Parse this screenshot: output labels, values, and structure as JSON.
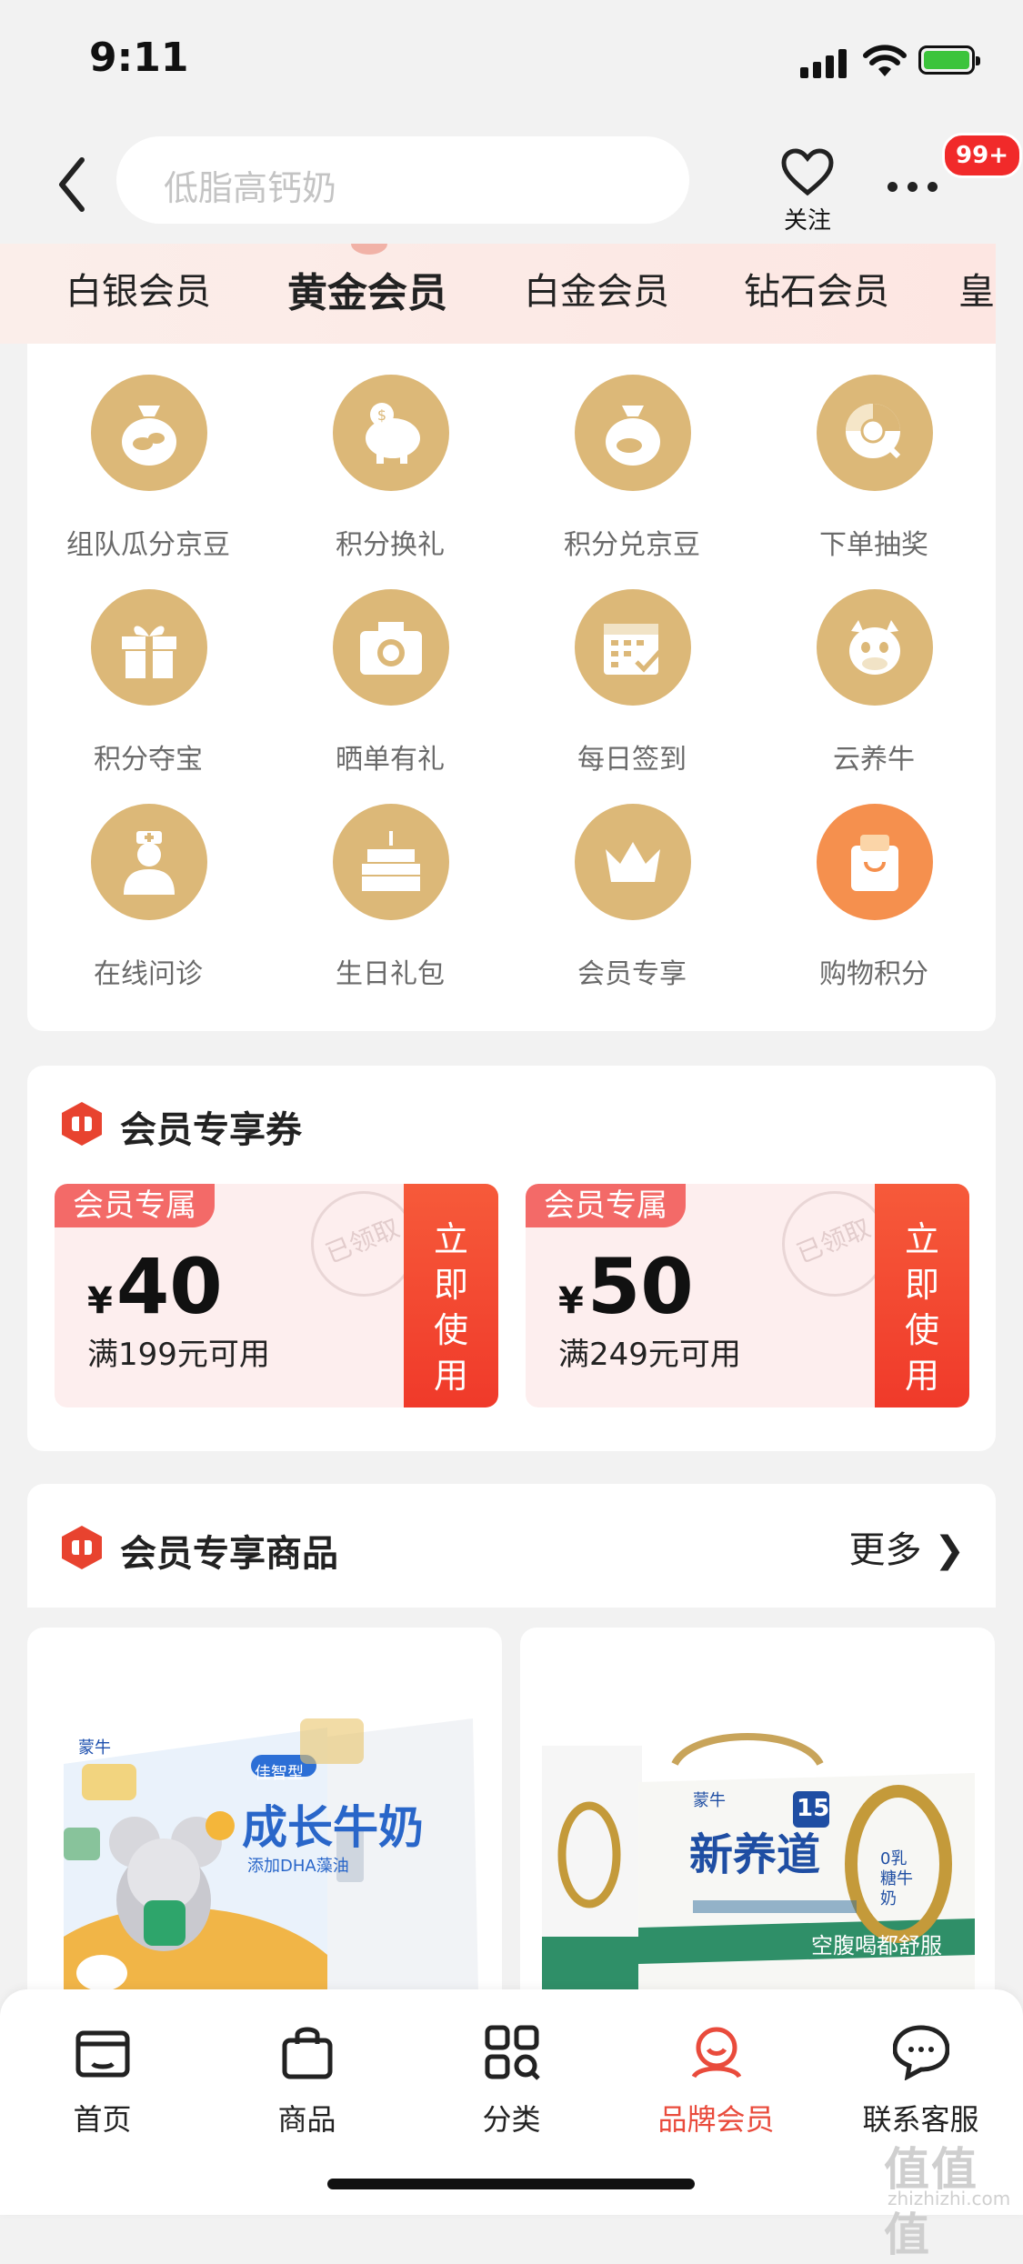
{
  "status": {
    "time": "9:11"
  },
  "header": {
    "search_placeholder": "低脂高钙奶",
    "follow_label": "关注",
    "badge": "99+"
  },
  "tiers": [
    "白银会员",
    "黄金会员",
    "白金会员",
    "钻石会员",
    "皇"
  ],
  "active_tier_index": 1,
  "benefits": [
    {
      "label": "组队瓜分京豆",
      "icon": "bean-bag-icon"
    },
    {
      "label": "积分换礼",
      "icon": "piggy-bank-icon"
    },
    {
      "label": "积分兑京豆",
      "icon": "bean-bag-icon"
    },
    {
      "label": "下单抽奖",
      "icon": "lottery-wheel-icon"
    },
    {
      "label": "积分夺宝",
      "icon": "gift-box-icon"
    },
    {
      "label": "晒单有礼",
      "icon": "camera-icon"
    },
    {
      "label": "每日签到",
      "icon": "calendar-icon"
    },
    {
      "label": "云养牛",
      "icon": "cow-icon"
    },
    {
      "label": "在线问诊",
      "icon": "doctor-icon"
    },
    {
      "label": "生日礼包",
      "icon": "cake-icon"
    },
    {
      "label": "会员专享",
      "icon": "crown-icon"
    },
    {
      "label": "购物积分",
      "icon": "shopping-bag-icon"
    }
  ],
  "coupons_section": {
    "title": "会员专享券",
    "coupons": [
      {
        "tag": "会员专属",
        "currency": "¥",
        "amount": "40",
        "condition": "满199元可用",
        "stamp": "已领取",
        "button": "立即使用"
      },
      {
        "tag": "会员专属",
        "currency": "¥",
        "amount": "50",
        "condition": "满249元可用",
        "stamp": "已领取",
        "button": "立即使用"
      }
    ]
  },
  "goods_section": {
    "title": "会员专享商品",
    "more": "更多",
    "more_arrow": "❯",
    "products": [
      {
        "brand": "蒙牛",
        "name": "成长牛奶",
        "sub": "佳智型",
        "note": "添加DHA藻油"
      },
      {
        "brand": "蒙牛",
        "name": "新养道",
        "sub": "0乳糖牛奶",
        "note": "空腹喝都舒服",
        "count": "15"
      }
    ]
  },
  "tabbar": [
    {
      "label": "首页",
      "icon": "shop-icon"
    },
    {
      "label": "商品",
      "icon": "bag-icon"
    },
    {
      "label": "分类",
      "icon": "category-icon"
    },
    {
      "label": "品牌会员",
      "icon": "member-icon"
    },
    {
      "label": "联系客服",
      "icon": "chat-icon"
    }
  ],
  "active_tab_index": 3,
  "watermark": {
    "mark": "值值值",
    "site": "zhizhizhi.com"
  },
  "colors": {
    "accent": "#e94b3c",
    "gold": "#dcb878",
    "coupon_bg": "#fdeeee"
  }
}
